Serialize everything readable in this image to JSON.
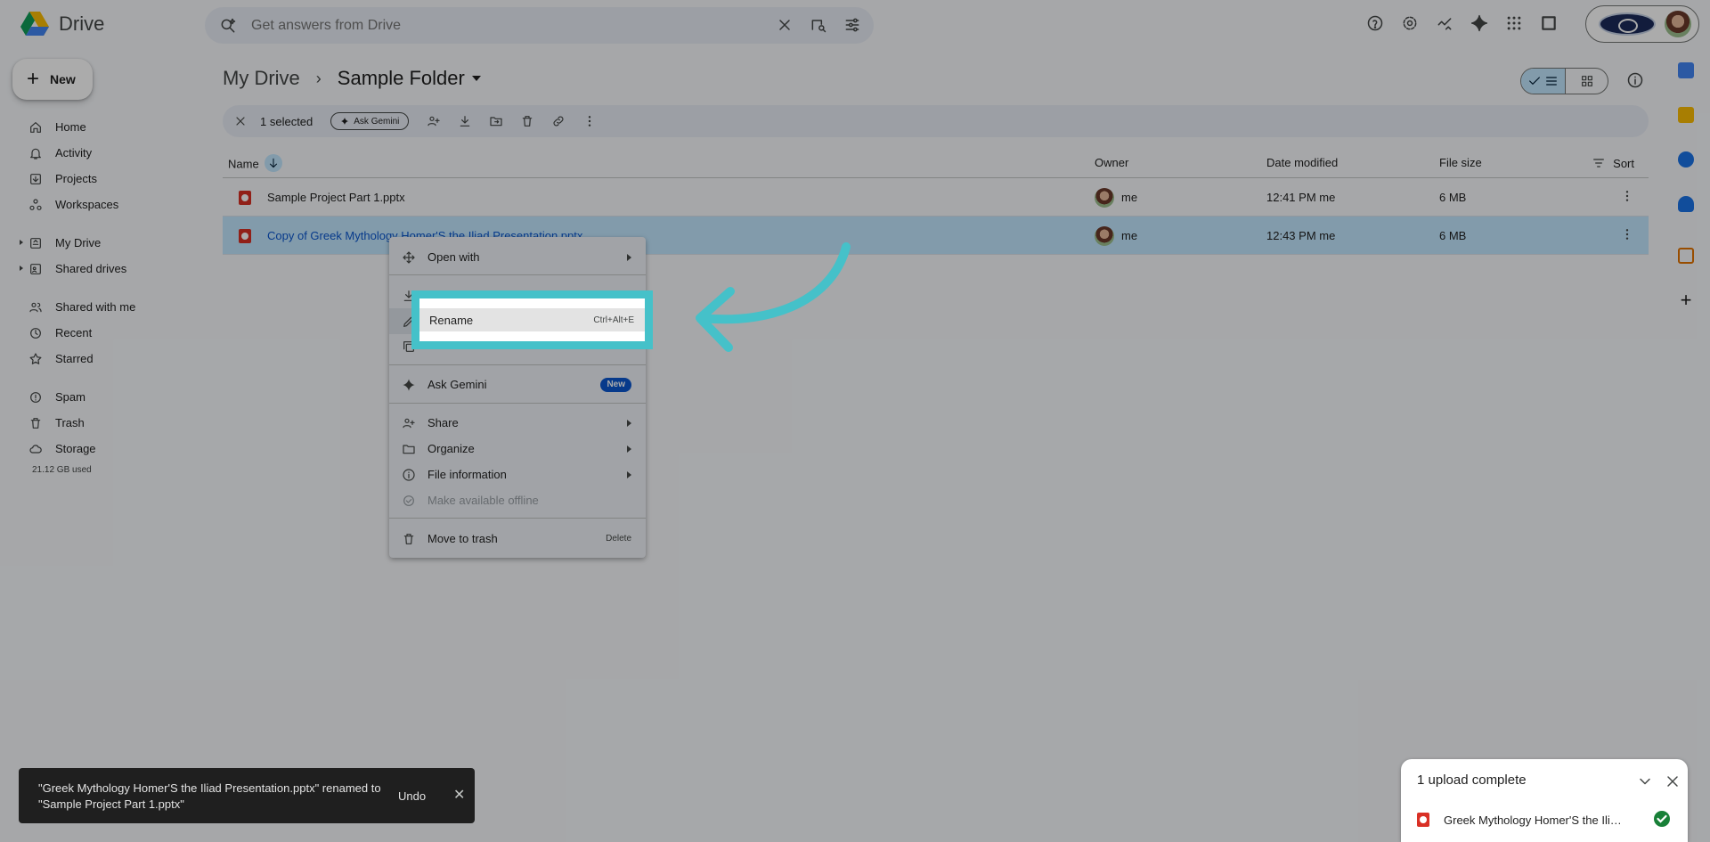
{
  "app": {
    "name": "Drive"
  },
  "search": {
    "placeholder": "Get answers from Drive"
  },
  "sidebar": {
    "new_label": "New",
    "items": [
      {
        "label": "Home"
      },
      {
        "label": "Activity"
      },
      {
        "label": "Projects"
      },
      {
        "label": "Workspaces"
      },
      {
        "label": "My Drive"
      },
      {
        "label": "Shared drives"
      },
      {
        "label": "Shared with me"
      },
      {
        "label": "Recent"
      },
      {
        "label": "Starred"
      },
      {
        "label": "Spam"
      },
      {
        "label": "Trash"
      },
      {
        "label": "Storage"
      }
    ],
    "storage_used": "21.12 GB used"
  },
  "breadcrumb": {
    "root": "My Drive",
    "folder": "Sample Folder"
  },
  "selection_bar": {
    "count": "1 selected",
    "ask_gemini": "Ask Gemini"
  },
  "table": {
    "headers": {
      "name": "Name",
      "owner": "Owner",
      "modified": "Date modified",
      "size": "File size",
      "sort": "Sort"
    },
    "rows": [
      {
        "name": "Sample Project Part 1.pptx",
        "owner": "me",
        "modified": "12:41 PM me",
        "size": "6 MB"
      },
      {
        "name": "Copy of Greek Mythology Homer'S the Iliad Presentation.pptx",
        "owner": "me",
        "modified": "12:43 PM me",
        "size": "6 MB"
      }
    ]
  },
  "context_menu": {
    "open_with": "Open with",
    "rename": "Rename",
    "rename_shortcut": "Ctrl+Alt+E",
    "ask_gemini": "Ask Gemini",
    "new_badge": "New",
    "share": "Share",
    "organize": "Organize",
    "file_information": "File information",
    "make_offline": "Make available offline",
    "move_to_trash": "Move to trash",
    "trash_shortcut": "Delete"
  },
  "toast": {
    "message": "\"Greek Mythology Homer'S the Iliad Presentation.pptx\" renamed to \"Sample Project Part 1.pptx\"",
    "undo": "Undo"
  },
  "upload_panel": {
    "title": "1 upload complete",
    "file": "Greek Mythology Homer'S the Iliad Presentation.pptx"
  },
  "colors": {
    "highlight": "#45c1c9",
    "selected_row": "#c2e7ff",
    "accent": "#0b57d0"
  }
}
